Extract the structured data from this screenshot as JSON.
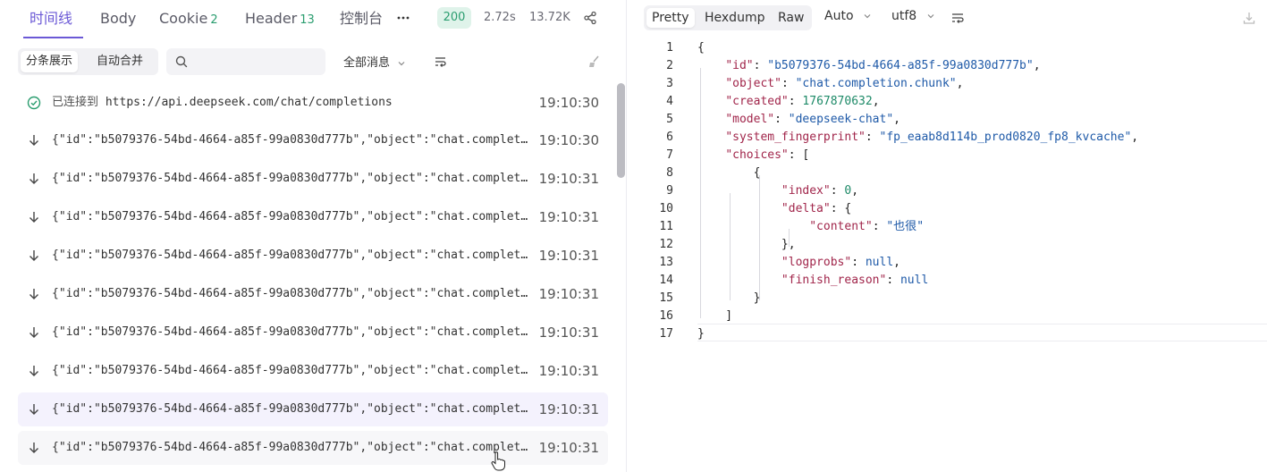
{
  "tabs": [
    {
      "label": "时间线",
      "count": ""
    },
    {
      "label": "Body",
      "count": ""
    },
    {
      "label": "Cookie",
      "count": "2"
    },
    {
      "label": "Header",
      "count": "13"
    },
    {
      "label": "控制台",
      "count": ""
    }
  ],
  "response_meta": {
    "status": "200",
    "time": "2.72s",
    "size": "13.72K"
  },
  "toolbar": {
    "mode_split": "分条展示",
    "mode_merge": "自动合并",
    "search_placeholder": "",
    "filter_label": "全部消息"
  },
  "timeline": {
    "connected": {
      "prefix": "已连接到",
      "url": "https://api.deepseek.com/chat/completions",
      "time": "19:10:30"
    },
    "messages": [
      {
        "text": "{\"id\":\"b5079376-54bd-4664-a85f-99a0830d777b\",\"object\":\"chat.completion.chunk\"",
        "time": "19:10:30"
      },
      {
        "text": "{\"id\":\"b5079376-54bd-4664-a85f-99a0830d777b\",\"object\":\"chat.completion.chunk\"",
        "time": "19:10:31"
      },
      {
        "text": "{\"id\":\"b5079376-54bd-4664-a85f-99a0830d777b\",\"object\":\"chat.completion.chunk\"",
        "time": "19:10:31"
      },
      {
        "text": "{\"id\":\"b5079376-54bd-4664-a85f-99a0830d777b\",\"object\":\"chat.completion.chunk\"",
        "time": "19:10:31"
      },
      {
        "text": "{\"id\":\"b5079376-54bd-4664-a85f-99a0830d777b\",\"object\":\"chat.completion.chunk\"",
        "time": "19:10:31"
      },
      {
        "text": "{\"id\":\"b5079376-54bd-4664-a85f-99a0830d777b\",\"object\":\"chat.completion.chunk\"",
        "time": "19:10:31"
      },
      {
        "text": "{\"id\":\"b5079376-54bd-4664-a85f-99a0830d777b\",\"object\":\"chat.completion.chunk\"",
        "time": "19:10:31"
      },
      {
        "text": "{\"id\":\"b5079376-54bd-4664-a85f-99a0830d777b\",\"object\":\"chat.completion.chunk\"",
        "time": "19:10:31"
      },
      {
        "text": "{\"id\":\"b5079376-54bd-4664-a85f-99a0830d777b\",\"object\":\"chat.completion.chunk\"",
        "time": "19:10:31"
      }
    ]
  },
  "viewer": {
    "modes": [
      "Pretty",
      "Hexdump",
      "Raw"
    ],
    "format": "Auto",
    "encoding": "utf8"
  },
  "json": {
    "id": "b5079376-54bd-4664-a85f-99a0830d777b",
    "object": "chat.completion.chunk",
    "created": "1767870632",
    "model": "deepseek-chat",
    "system_fingerprint": "fp_eaab8d114b_prod0820_fp8_kvcache",
    "index": "0",
    "content": "也很",
    "logprobs": "null",
    "finish_reason": "null"
  },
  "colors": {
    "accent": "#6b59d6",
    "success": "#2a9d6f",
    "json_key": "#a1264b",
    "json_string": "#1f5aa8",
    "json_number": "#1e8a68"
  }
}
